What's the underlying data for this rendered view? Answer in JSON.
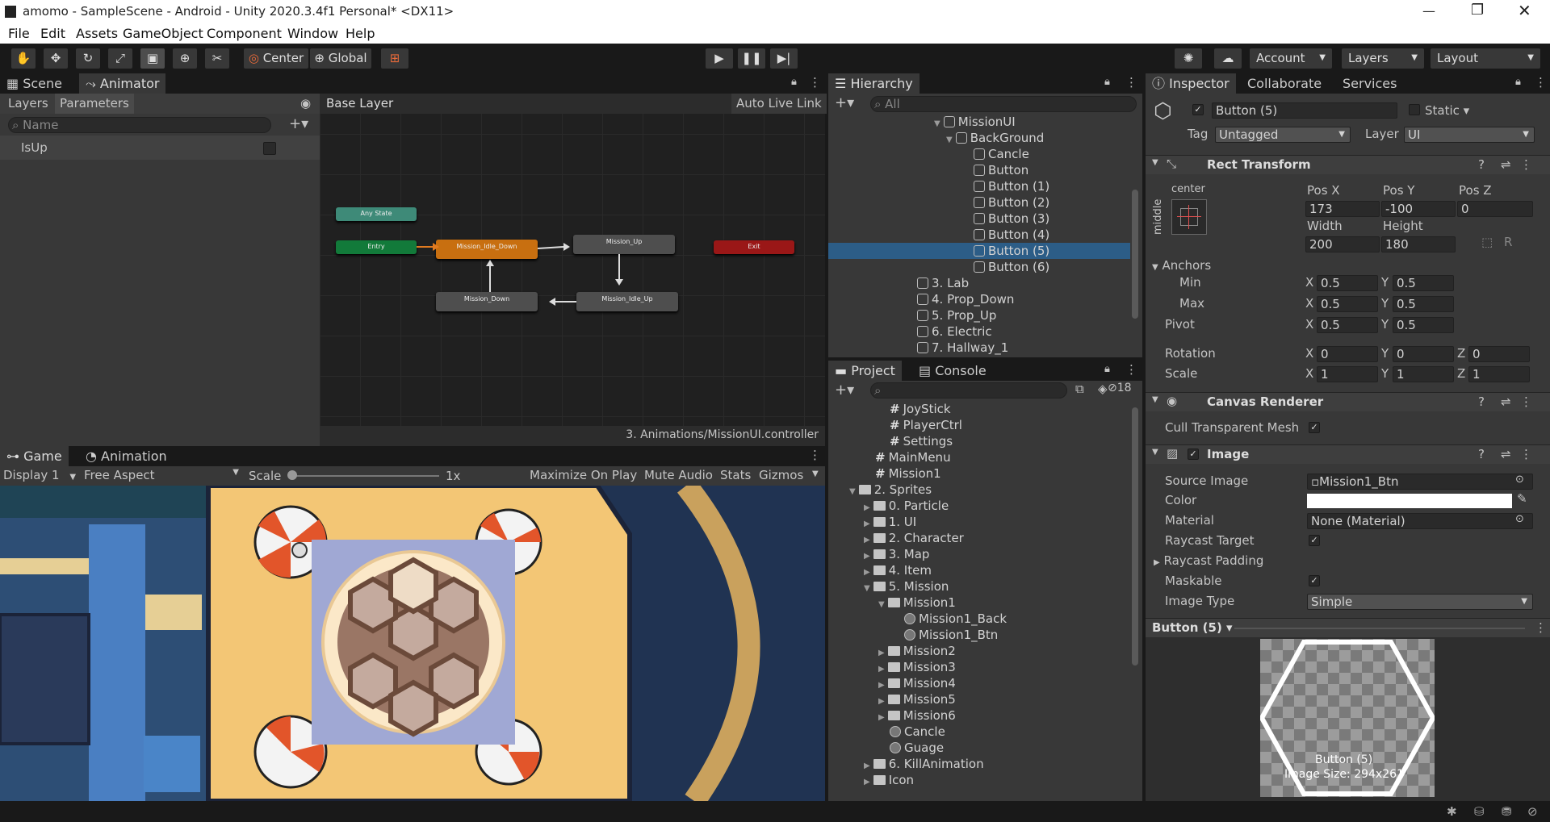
{
  "window": {
    "title": "amomo - SampleScene - Android - Unity 2020.3.4f1 Personal* <DX11>"
  },
  "menu": [
    "File",
    "Edit",
    "Assets",
    "GameObject",
    "Component",
    "Window",
    "Help"
  ],
  "toolbar": {
    "center": "Center",
    "global": "Global",
    "account": "Account",
    "layers": "Layers",
    "layout": "Layout"
  },
  "animator": {
    "tabs": [
      "Scene",
      "Animator"
    ],
    "left_tabs": [
      "Layers",
      "Parameters"
    ],
    "name_placeholder": "Name",
    "params": [
      {
        "name": "IsUp",
        "value": false
      }
    ],
    "breadcrumb": "Base Layer",
    "auto_live_link": "Auto Live Link",
    "nodes": [
      "Any State",
      "Entry",
      "Mission_Idle_Down",
      "Mission_Up",
      "Exit",
      "Mission_Down",
      "Mission_Idle_Up"
    ],
    "footer": "3. Animations/MissionUI.controller"
  },
  "game": {
    "tabs": [
      "Game",
      "Animation"
    ],
    "display": "Display 1",
    "aspect": "Free Aspect",
    "scale_label": "Scale",
    "scale_value": "1x",
    "buttons": [
      "Maximize On Play",
      "Mute Audio",
      "Stats",
      "Gizmos"
    ]
  },
  "hierarchy": {
    "tab": "Hierarchy",
    "search_placeholder": "All",
    "items": [
      {
        "label": "MissionUI",
        "indent": 0
      },
      {
        "label": "BackGround",
        "indent": 1
      },
      {
        "label": "Cancle",
        "indent": 2
      },
      {
        "label": "Button",
        "indent": 2
      },
      {
        "label": "Button (1)",
        "indent": 2
      },
      {
        "label": "Button (2)",
        "indent": 2
      },
      {
        "label": "Button (3)",
        "indent": 2
      },
      {
        "label": "Button (4)",
        "indent": 2
      },
      {
        "label": "Button (5)",
        "indent": 2,
        "selected": true
      },
      {
        "label": "Button (6)",
        "indent": 2
      },
      {
        "label": "3. Lab",
        "indent": -1
      },
      {
        "label": "4. Prop_Down",
        "indent": -1
      },
      {
        "label": "5. Prop_Up",
        "indent": -1
      },
      {
        "label": "6. Electric",
        "indent": -1
      },
      {
        "label": "7. Hallway_1",
        "indent": -1
      }
    ]
  },
  "project": {
    "tabs": [
      "Project",
      "Console"
    ],
    "hidden_count": "18",
    "items": [
      {
        "label": "JoyStick",
        "kind": "script",
        "indent": 2
      },
      {
        "label": "PlayerCtrl",
        "kind": "script",
        "indent": 2
      },
      {
        "label": "Settings",
        "kind": "script",
        "indent": 2
      },
      {
        "label": "MainMenu",
        "kind": "script",
        "indent": 1
      },
      {
        "label": "Mission1",
        "kind": "script",
        "indent": 1
      },
      {
        "label": "2. Sprites",
        "kind": "folder",
        "indent": 0,
        "open": true
      },
      {
        "label": "0. Particle",
        "kind": "folder",
        "indent": 1
      },
      {
        "label": "1. UI",
        "kind": "folder",
        "indent": 1
      },
      {
        "label": "2. Character",
        "kind": "folder",
        "indent": 1
      },
      {
        "label": "3. Map",
        "kind": "folder",
        "indent": 1
      },
      {
        "label": "4. Item",
        "kind": "folder",
        "indent": 1
      },
      {
        "label": "5. Mission",
        "kind": "folder",
        "indent": 1,
        "open": true
      },
      {
        "label": "Mission1",
        "kind": "folder",
        "indent": 2,
        "open": true
      },
      {
        "label": "Mission1_Back",
        "kind": "sprite",
        "indent": 3
      },
      {
        "label": "Mission1_Btn",
        "kind": "sprite",
        "indent": 3
      },
      {
        "label": "Mission2",
        "kind": "folder",
        "indent": 2
      },
      {
        "label": "Mission3",
        "kind": "folder",
        "indent": 2
      },
      {
        "label": "Mission4",
        "kind": "folder",
        "indent": 2
      },
      {
        "label": "Mission5",
        "kind": "folder",
        "indent": 2
      },
      {
        "label": "Mission6",
        "kind": "folder",
        "indent": 2
      },
      {
        "label": "Cancle",
        "kind": "sprite",
        "indent": 2
      },
      {
        "label": "Guage",
        "kind": "sprite",
        "indent": 2
      },
      {
        "label": "6. KillAnimation",
        "kind": "folder",
        "indent": 1
      },
      {
        "label": "Icon",
        "kind": "folder",
        "indent": 1
      }
    ]
  },
  "inspector": {
    "tabs": [
      "Inspector",
      "Collaborate",
      "Services"
    ],
    "object_name": "Button (5)",
    "static_label": "Static",
    "tag_label": "Tag",
    "tag": "Untagged",
    "layer_label": "Layer",
    "layer": "UI",
    "rect": {
      "header": "Rect Transform",
      "anchor_h": "center",
      "anchor_v": "middle",
      "labels": {
        "posx": "Pos X",
        "posy": "Pos Y",
        "posz": "Pos Z",
        "width": "Width",
        "height": "Height"
      },
      "posx": "173",
      "posy": "-100",
      "posz": "0",
      "width": "200",
      "height": "180",
      "anchors": "Anchors",
      "min": "Min",
      "max": "Max",
      "pivot": "Pivot",
      "min_x": "0.5",
      "min_y": "0.5",
      "max_x": "0.5",
      "max_y": "0.5",
      "pivot_x": "0.5",
      "pivot_y": "0.5",
      "rotation": "Rotation",
      "rot_x": "0",
      "rot_y": "0",
      "rot_z": "0",
      "scale": "Scale",
      "scale_x": "1",
      "scale_y": "1",
      "scale_z": "1",
      "axis_x": "X",
      "axis_y": "Y",
      "axis_z": "Z",
      "r_btn": "R"
    },
    "canvas": {
      "header": "Canvas Renderer",
      "cull": "Cull Transparent Mesh"
    },
    "image": {
      "header": "Image",
      "source_label": "Source Image",
      "source": "Mission1_Btn",
      "color_label": "Color",
      "material_label": "Material",
      "material": "None (Material)",
      "raycast_target": "Raycast Target",
      "raycast_padding": "Raycast Padding",
      "maskable": "Maskable",
      "type_label": "Image Type",
      "type": "Simple"
    },
    "preview": {
      "title": "Button (5)",
      "name": "Button (5)",
      "size": "Image Size: 294x261"
    }
  },
  "colors": {
    "selection": "#2c5d87",
    "entry": "#127a3a",
    "default_state": "#c86f10",
    "exit": "#9a1717",
    "any_state": "#3e8a78"
  }
}
